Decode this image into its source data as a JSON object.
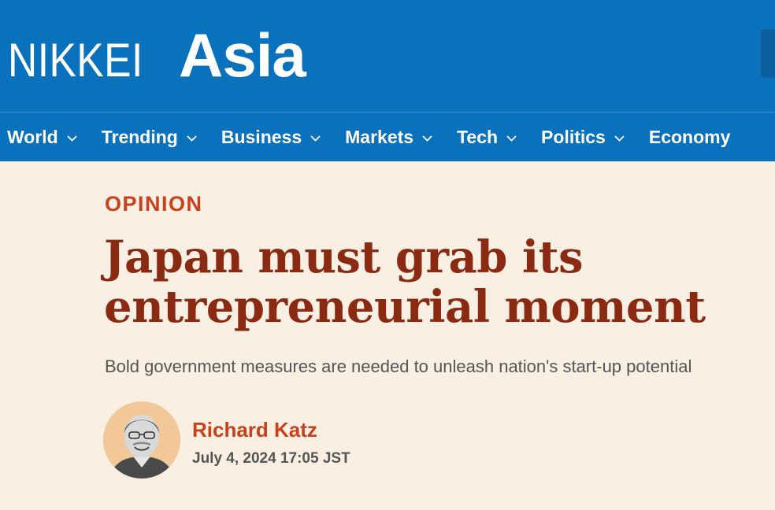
{
  "brand": {
    "name_light": "NIKKEI",
    "name_bold": "Asia"
  },
  "nav": {
    "items": [
      {
        "label": "World"
      },
      {
        "label": "Trending"
      },
      {
        "label": "Business"
      },
      {
        "label": "Markets"
      },
      {
        "label": "Tech"
      },
      {
        "label": "Politics"
      },
      {
        "label": "Economy"
      }
    ]
  },
  "article": {
    "kicker": "OPINION",
    "headline": "Japan must grab its entrepreneurial moment",
    "standfirst": "Bold government measures are needed to unleash nation's start-up potential",
    "author": "Richard Katz",
    "timestamp": "July 4, 2024 17:05 JST"
  },
  "colors": {
    "header_bg": "#0a72bd",
    "page_bg": "#f9efe2",
    "accent_orange": "#c8401c",
    "headline_brown": "#8b2a12",
    "text_grey": "#555555",
    "avatar_bg": "#f3c898"
  },
  "icons": {
    "nav_dropdown": "chevron-down-icon"
  }
}
